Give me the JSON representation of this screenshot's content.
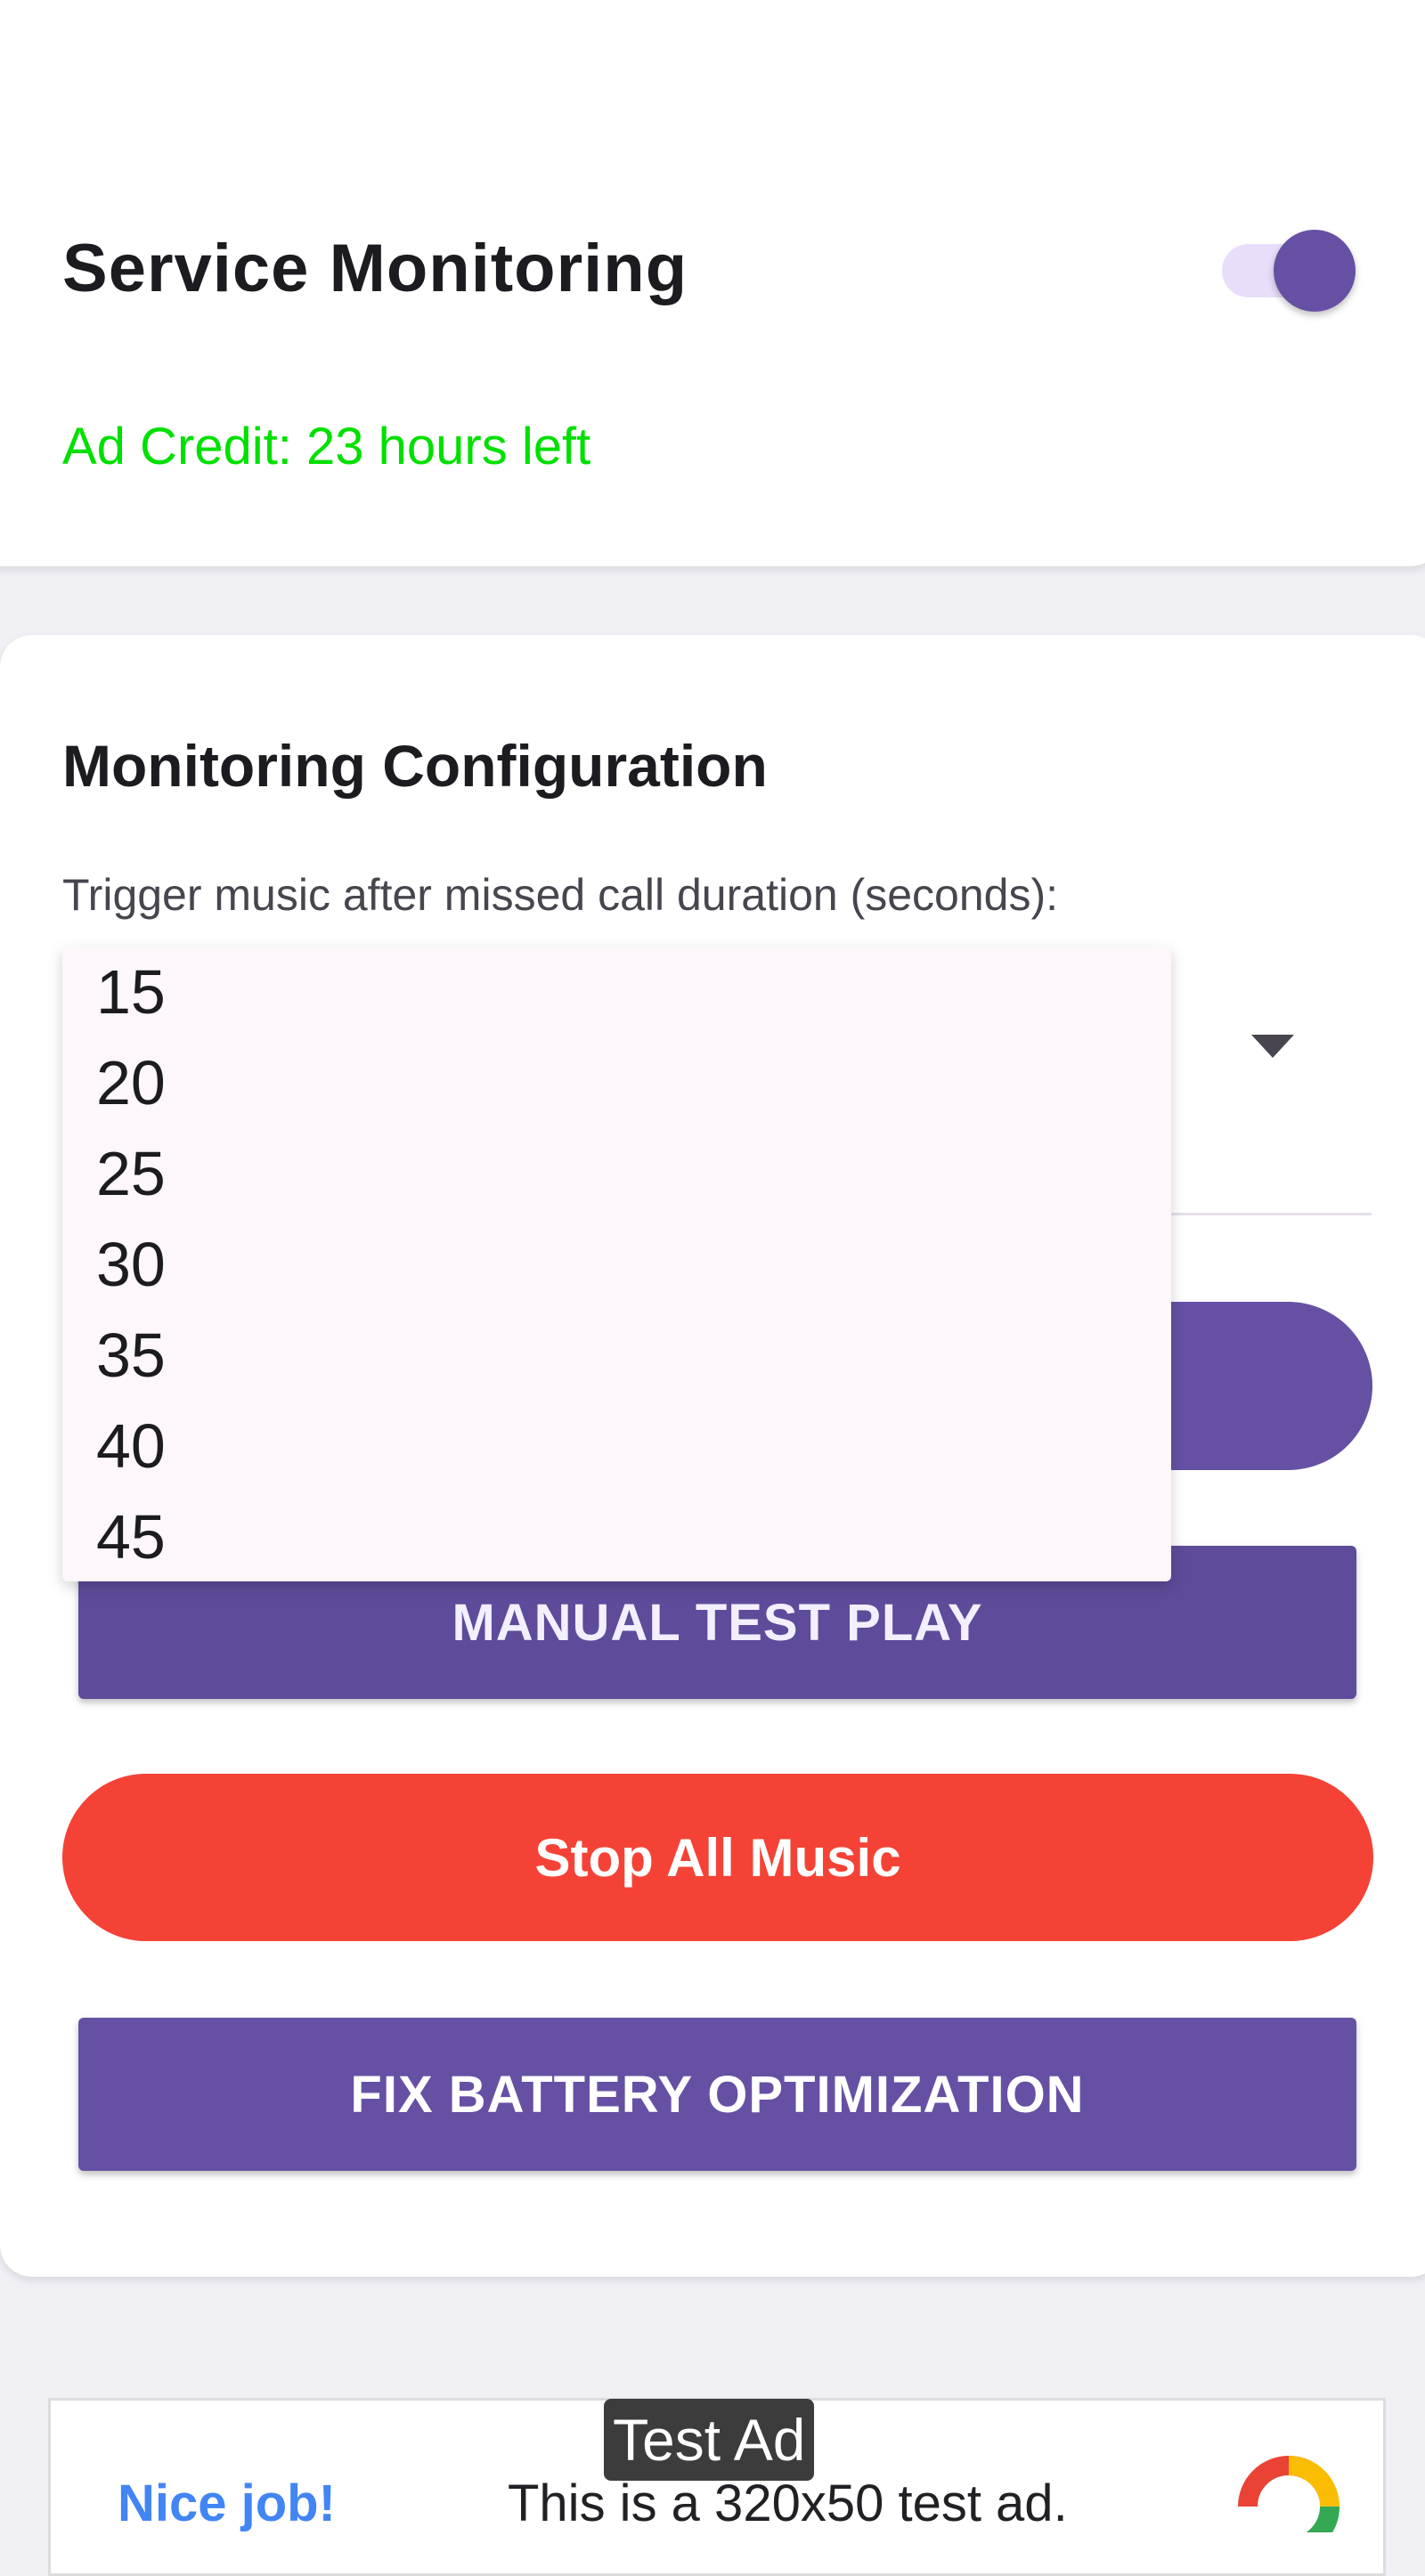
{
  "service": {
    "title": "Service Monitoring",
    "toggle_on": true,
    "ad_credit": "Ad Credit: 23 hours left"
  },
  "config": {
    "title": "Monitoring Configuration",
    "trigger_label": "Trigger music after missed call duration (seconds):",
    "options": [
      "15",
      "20",
      "25",
      "30",
      "35",
      "40",
      "45"
    ]
  },
  "buttons": {
    "manual_test": "MANUAL TEST PLAY",
    "stop_all": "Stop All Music",
    "fix_battery": "FIX BATTERY OPTIMIZATION"
  },
  "ad": {
    "label": "Test Ad",
    "nice": "Nice job!",
    "text": "This is a 320x50 test ad."
  },
  "colors": {
    "accent": "#6650a4",
    "stop": "#f44336",
    "ad_credit": "#00e000",
    "ad_link": "#4285f4"
  },
  "icons": {
    "dropdown": "arrow-drop-down-icon",
    "ad_logo": "google-ads-logo-icon"
  }
}
